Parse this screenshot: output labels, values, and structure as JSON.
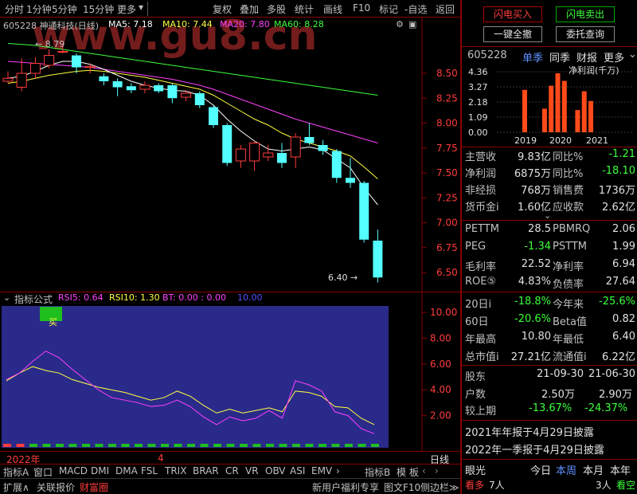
{
  "toolbar": {
    "left": [
      "分时",
      "1分钟",
      "5分钟",
      "15分钟",
      "更多"
    ],
    "right": [
      "复权",
      "叠加",
      "多股",
      "统计",
      "画线",
      "F10",
      "标记",
      "-自选",
      "返回"
    ]
  },
  "stock": {
    "code_name": "605228 神通科技(日线)",
    "ma_labels": [
      "MA5: 7.18",
      "MA10: 7.44",
      "MA20: 7.80",
      "MA60: 8.28"
    ],
    "high_marker": "8.79",
    "low_marker": "6.40",
    "price_ticks": [
      "8.50",
      "8.25",
      "8.00",
      "7.75",
      "7.50",
      "7.25",
      "7.00",
      "6.75",
      "6.50"
    ],
    "watermark": "www.gu8.cn"
  },
  "colors": {
    "up": "#ff3c3c",
    "down": "#54ffff",
    "ma5": "#ffffff",
    "ma10": "#ffff40",
    "ma20": "#ff40ff",
    "ma60": "#3cff3c",
    "ind_bg": "#2a2a8a"
  },
  "candles": [
    {
      "o": 8.42,
      "c": 8.45,
      "h": 8.52,
      "l": 8.4
    },
    {
      "o": 8.36,
      "c": 8.5,
      "h": 8.65,
      "l": 8.32
    },
    {
      "o": 8.5,
      "c": 8.6,
      "h": 8.66,
      "l": 8.45
    },
    {
      "o": 8.58,
      "c": 8.68,
      "h": 8.74,
      "l": 8.55
    },
    {
      "o": 8.72,
      "c": 8.72,
      "h": 8.79,
      "l": 8.7
    },
    {
      "o": 8.68,
      "c": 8.56,
      "h": 8.7,
      "l": 8.5
    },
    {
      "o": 8.56,
      "c": 8.57,
      "h": 8.6,
      "l": 8.5
    },
    {
      "o": 8.47,
      "c": 8.42,
      "h": 8.5,
      "l": 8.38
    },
    {
      "o": 8.42,
      "c": 8.36,
      "h": 8.45,
      "l": 8.27
    },
    {
      "o": 8.37,
      "c": 8.33,
      "h": 8.4,
      "l": 8.3
    },
    {
      "o": 8.34,
      "c": 8.38,
      "h": 8.42,
      "l": 8.3
    },
    {
      "o": 8.38,
      "c": 8.32,
      "h": 8.4,
      "l": 8.3
    },
    {
      "o": 8.38,
      "c": 8.25,
      "h": 8.4,
      "l": 8.2
    },
    {
      "o": 8.26,
      "c": 8.3,
      "h": 8.33,
      "l": 8.22
    },
    {
      "o": 8.3,
      "c": 8.18,
      "h": 8.32,
      "l": 8.15
    },
    {
      "o": 8.16,
      "c": 7.98,
      "h": 8.18,
      "l": 7.95
    },
    {
      "o": 7.98,
      "c": 7.6,
      "h": 8.0,
      "l": 7.57
    },
    {
      "o": 7.62,
      "c": 7.74,
      "h": 7.78,
      "l": 7.55
    },
    {
      "o": 7.62,
      "c": 7.8,
      "h": 7.82,
      "l": 7.52
    },
    {
      "o": 7.66,
      "c": 7.7,
      "h": 7.78,
      "l": 7.62
    },
    {
      "o": 7.7,
      "c": 7.6,
      "h": 7.8,
      "l": 7.55
    },
    {
      "o": 7.66,
      "c": 7.86,
      "h": 7.9,
      "l": 7.55
    },
    {
      "o": 7.86,
      "c": 7.8,
      "h": 8.0,
      "l": 7.78
    },
    {
      "o": 7.78,
      "c": 7.72,
      "h": 7.83,
      "l": 7.68
    },
    {
      "o": 7.72,
      "c": 7.45,
      "h": 7.74,
      "l": 7.4
    },
    {
      "o": 7.45,
      "c": 7.4,
      "h": 7.65,
      "l": 7.35
    },
    {
      "o": 7.4,
      "c": 6.83,
      "h": 7.42,
      "l": 6.8
    },
    {
      "o": 6.82,
      "c": 6.45,
      "h": 6.93,
      "l": 6.4
    }
  ],
  "ma_series": {
    "ma5": [
      8.45,
      8.47,
      8.52,
      8.58,
      8.62,
      8.62,
      8.59,
      8.54,
      8.48,
      8.42,
      8.38,
      8.35,
      8.33,
      8.32,
      8.28,
      8.18,
      8.04,
      7.92,
      7.82,
      7.74,
      7.72,
      7.74,
      7.76,
      7.73,
      7.64,
      7.55,
      7.35,
      7.18
    ],
    "ma10": [
      8.4,
      8.42,
      8.45,
      8.48,
      8.5,
      8.52,
      8.53,
      8.52,
      8.5,
      8.48,
      8.46,
      8.43,
      8.4,
      8.37,
      8.34,
      8.28,
      8.2,
      8.12,
      8.04,
      7.98,
      7.9,
      7.84,
      7.8,
      7.76,
      7.72,
      7.67,
      7.56,
      7.44
    ],
    "ma20": [
      8.62,
      8.61,
      8.6,
      8.59,
      8.58,
      8.57,
      8.56,
      8.54,
      8.52,
      8.5,
      8.48,
      8.46,
      8.44,
      8.41,
      8.38,
      8.34,
      8.29,
      8.24,
      8.19,
      8.14,
      8.09,
      8.04,
      8.0,
      7.96,
      7.92,
      7.88,
      7.84,
      7.8
    ],
    "ma60": [
      8.8,
      8.79,
      8.78,
      8.76,
      8.74,
      8.72,
      8.7,
      8.68,
      8.66,
      8.64,
      8.62,
      8.6,
      8.58,
      8.56,
      8.54,
      8.52,
      8.5,
      8.48,
      8.46,
      8.44,
      8.42,
      8.4,
      8.38,
      8.36,
      8.34,
      8.32,
      8.3,
      8.28
    ]
  },
  "indicator": {
    "title": "指标公式",
    "rsi5_label": "RSI5: 0.64",
    "rsi10_label": "RSI10: 1.30",
    "bt_label": "BT: 0.00 : 0.00",
    "extra": "10.00",
    "ticks": [
      "10.00",
      "8.00",
      "6.00",
      "4.00",
      "2.00"
    ],
    "buy_marker": "买",
    "rsi5": [
      4.8,
      5.3,
      6.2,
      7.0,
      6.5,
      5.6,
      4.8,
      4.0,
      3.4,
      3.2,
      3.0,
      2.7,
      2.8,
      3.2,
      2.7,
      1.9,
      1.3,
      1.9,
      1.6,
      1.8,
      2.4,
      1.8,
      4.7,
      4.4,
      3.9,
      2.3,
      2.0,
      1.0,
      0.6
    ],
    "rsi10": [
      4.7,
      5.3,
      5.8,
      5.5,
      5.3,
      4.8,
      4.5,
      4.2,
      4.0,
      3.8,
      3.5,
      3.2,
      3.4,
      3.9,
      3.5,
      2.8,
      2.2,
      2.5,
      2.2,
      2.4,
      2.6,
      2.3,
      3.9,
      3.8,
      3.5,
      2.7,
      2.6,
      1.8,
      1.3
    ]
  },
  "time_axis": {
    "left_label": "2022年",
    "mid_label": "4",
    "right_label": "日线"
  },
  "bottom_tabs": [
    "指标A",
    "窗口",
    "MACD",
    "DMI",
    "DMA",
    "FSL",
    "TRIX",
    "BRAR",
    "CR",
    "VR",
    "OBV",
    "ASI",
    "EMV",
    "指标B",
    "模",
    "板"
  ],
  "bottom_bar": {
    "left": [
      "扩展∧",
      "关联报价",
      "财富圈"
    ],
    "right": [
      "新用户福利专享",
      "图文F10",
      "侧边栏≫"
    ]
  },
  "right_panel": {
    "buttons": {
      "flash_buy": "闪电买入",
      "flash_sell": "闪电卖出",
      "one_click_cancel": "一键全撤",
      "order_query": "委托查询"
    },
    "stock_code": "605228",
    "tabs": [
      "单季",
      "同季",
      "财报",
      "更多"
    ],
    "fin_chart_title": "净利润(千万)",
    "fin_y_ticks": [
      "4.36",
      "3.27",
      "2.18",
      "1.09",
      "0.00"
    ],
    "fin_x_labels": [
      "2019",
      "2020",
      "2021"
    ],
    "fin_bars": [
      3.05,
      0,
      0,
      1.7,
      3.35,
      4.25,
      3.7,
      0,
      1.6,
      2.95,
      2.25,
      0,
      0
    ],
    "fin_rows": [
      {
        "k1": "主营收",
        "v1": "9.83亿",
        "k2": "同比%",
        "v2": "-1.21"
      },
      {
        "k1": "净利润",
        "v1": "6875万",
        "k2": "同比%",
        "v2": "-18.10"
      },
      {
        "k1": "非经损",
        "v1": "768万",
        "k2": "销售费",
        "v2": "1736万"
      },
      {
        "k1": "货币金i",
        "v1": "1.60亿",
        "k2": "应收款",
        "v2": "2.62亿"
      }
    ],
    "val_rows": [
      {
        "k1": "PETTM",
        "v1": "28.5",
        "k2": "PBMRQ",
        "v2": "2.06"
      },
      {
        "k1": "PEG",
        "v1": "-1.34",
        "k2": "PSTTM",
        "v2": "1.99"
      },
      {
        "k1": "毛利率",
        "v1": "22.52",
        "k2": "净利率",
        "v2": "6.94"
      },
      {
        "k1": "ROE⑤",
        "v1": "4.83%",
        "k2": "负债率",
        "v2": "27.64"
      }
    ],
    "perf_rows": [
      {
        "k1": "20日i",
        "v1": "-18.8%",
        "k2": "今年来",
        "v2": "-25.6%"
      },
      {
        "k1": "60日",
        "v1": "-20.6%",
        "k2": "Beta值",
        "v2": "0.82"
      },
      {
        "k1": "年最高",
        "v1": "10.80",
        "k2": "年最低",
        "v2": "6.40"
      },
      {
        "k1": "总市值i",
        "v1": "27.21亿",
        "k2": "流通值i",
        "v2": "6.22亿"
      }
    ],
    "holders": {
      "header": {
        "k": "股东",
        "d1": "21-09-30",
        "d2": "21-06-30"
      },
      "count": {
        "k": "户数",
        "v1": "2.50万",
        "v2": "2.90万"
      },
      "change": {
        "k": "较上期",
        "v1": "-13.67%",
        "v2": "-24.37%"
      }
    },
    "disclosures": [
      "2021年年报于4月29日披露",
      "2022年一季报于4月29日披露"
    ],
    "bottom": {
      "label": "眼光",
      "tabs": [
        "今日",
        "本周",
        "本月",
        "本年"
      ],
      "bull": "看多",
      "bull_count": "7人",
      "bear_count": "3人",
      "bear": "看空"
    }
  }
}
